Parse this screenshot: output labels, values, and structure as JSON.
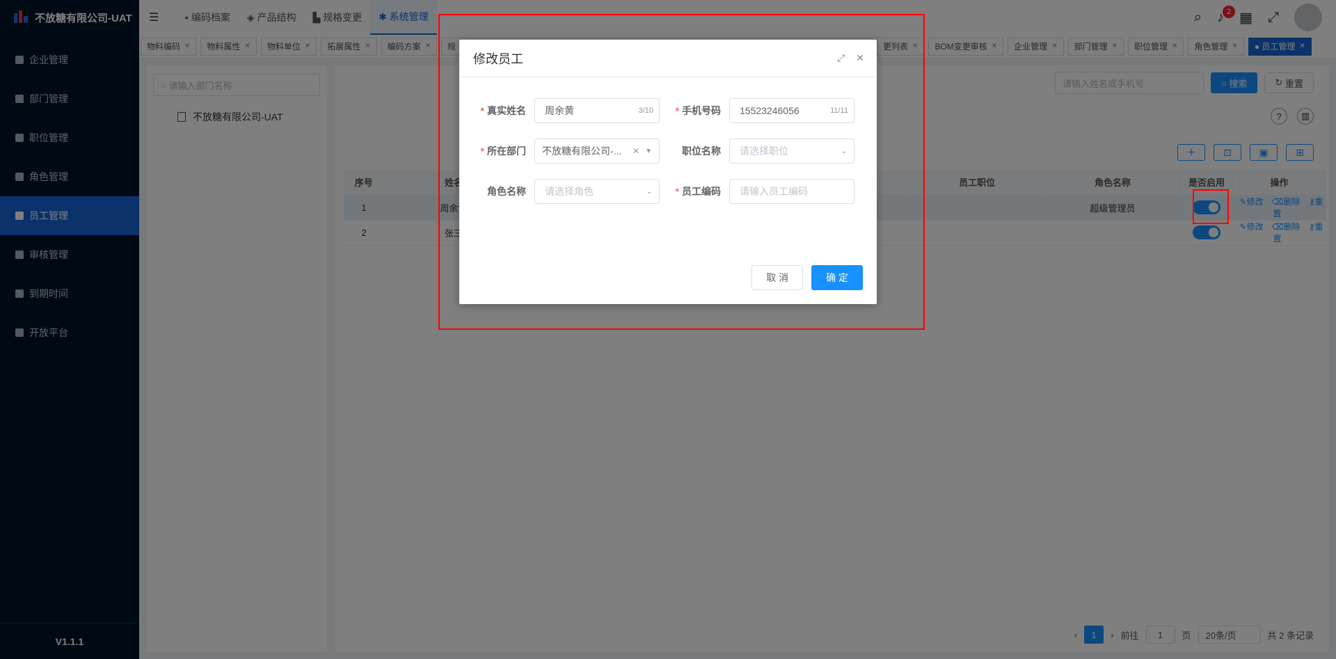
{
  "app": {
    "title": "不放糖有限公司-UAT",
    "version": "V1.1.1"
  },
  "sidebar": {
    "items": [
      {
        "label": "企业管理",
        "icon": "building-icon"
      },
      {
        "label": "部门管理",
        "icon": "org-chart-icon"
      },
      {
        "label": "职位管理",
        "icon": "id-card-icon"
      },
      {
        "label": "角色管理",
        "icon": "role-icon"
      },
      {
        "label": "员工管理",
        "icon": "user-icon",
        "active": true
      },
      {
        "label": "审核管理",
        "icon": "check-square-icon"
      },
      {
        "label": "到期时间",
        "icon": "calendar-icon"
      },
      {
        "label": "开放平台",
        "icon": "platform-icon"
      }
    ]
  },
  "topbar": {
    "collapse_icon": "menu-fold-icon",
    "menus": [
      "编码档案",
      "产品结构",
      "规格变更",
      "系统管理"
    ],
    "active_menu": "系统管理",
    "badge_count": "2"
  },
  "tags": [
    "物料编码",
    "物料属性",
    "物料单位",
    "拓展属性",
    "编码方案",
    "规",
    "",
    "",
    "",
    "",
    "",
    "",
    "更列表",
    "BOM变更审核",
    "企业管理",
    "部门管理",
    "职位管理",
    "角色管理",
    "员工管理"
  ],
  "tree": {
    "search_placeholder": "请输入部门名称",
    "root": "不放糖有限公司-UAT"
  },
  "filter": {
    "placeholder": "请输入姓名或手机号",
    "search": "搜索",
    "reset": "重置"
  },
  "table": {
    "headers": [
      "序号",
      "姓名",
      "",
      "",
      "员工职位",
      "角色名称",
      "是否启用",
      "操作"
    ],
    "rows": [
      {
        "index": "1",
        "name": "周余黄",
        "position": "",
        "role": "超级管理员",
        "enabled": true
      },
      {
        "index": "2",
        "name": "张三",
        "position": "",
        "role": "",
        "enabled": true
      }
    ],
    "ops": {
      "edit": "修改",
      "delete": "删除",
      "reset": "重置"
    }
  },
  "pager": {
    "current": "1",
    "goto_label": "前往",
    "goto_value": "1",
    "page_unit": "页",
    "page_size": "20条/页",
    "total": "共 2 条记录"
  },
  "dialog": {
    "title": "修改员工",
    "fields": {
      "real_name": {
        "label": "真实姓名",
        "value": "周余黄",
        "count": "3/10"
      },
      "phone": {
        "label": "手机号码",
        "value": "15523246056",
        "count": "11/11"
      },
      "department": {
        "label": "所在部门",
        "value": "不放糖有限公司-..."
      },
      "position": {
        "label": "职位名称",
        "placeholder": "请选择职位"
      },
      "role": {
        "label": "角色名称",
        "placeholder": "请选择角色"
      },
      "emp_code": {
        "label": "员工编码",
        "placeholder": "请输入员工编码"
      }
    },
    "cancel": "取 消",
    "confirm": "确 定"
  }
}
